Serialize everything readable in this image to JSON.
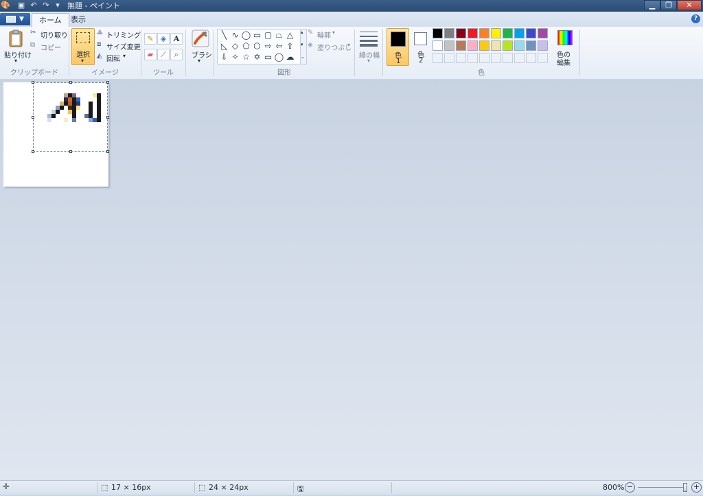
{
  "window": {
    "title": "無題 - ペイント",
    "minimize_glyph": "▁",
    "restore_glyph": "❐",
    "close_glyph": "✕"
  },
  "tabs": {
    "home": "ホーム",
    "view": "表示"
  },
  "help_glyph": "?",
  "clipboard": {
    "paste": "貼り付け",
    "cut": "切り取り",
    "copy": "コピー",
    "group": "クリップボード"
  },
  "image": {
    "select": "選択",
    "crop": "トリミング",
    "resize": "サイズ変更",
    "rotate": "回転",
    "group": "イメージ"
  },
  "tools": {
    "group": "ツール",
    "text_glyph": "A"
  },
  "brushes": {
    "label": "ブラシ"
  },
  "shapes": {
    "outline": "輪郭",
    "fill": "塗りつぶし",
    "group": "図形"
  },
  "size": {
    "label": "線の幅"
  },
  "colors": {
    "color1": "色\n1",
    "color1_top": "色",
    "color1_num": "1",
    "color2_top": "色",
    "color2_num": "2",
    "edit_top": "色の",
    "edit_bottom": "編集",
    "group": "色",
    "color1_value": "#000000",
    "color2_value": "#ffffff",
    "palette_row1": [
      "#000000",
      "#7f7f7f",
      "#880015",
      "#ed1c24",
      "#ff7f27",
      "#fff200",
      "#22b14c",
      "#00a2e8",
      "#3f48cc",
      "#a349a4"
    ],
    "palette_row2": [
      "#ffffff",
      "#c3c3c3",
      "#b97a57",
      "#ffaec9",
      "#ffc90e",
      "#efe4b0",
      "#b5e61d",
      "#99d9ea",
      "#7092be",
      "#c8bfe7"
    ]
  },
  "status": {
    "selection_size": "17 × 16px",
    "image_size": "24 × 24px",
    "zoom": "800%",
    "zoom_minus": "−",
    "zoom_plus": "+",
    "zoom_level": 1.0
  },
  "accent": "#fbc862"
}
